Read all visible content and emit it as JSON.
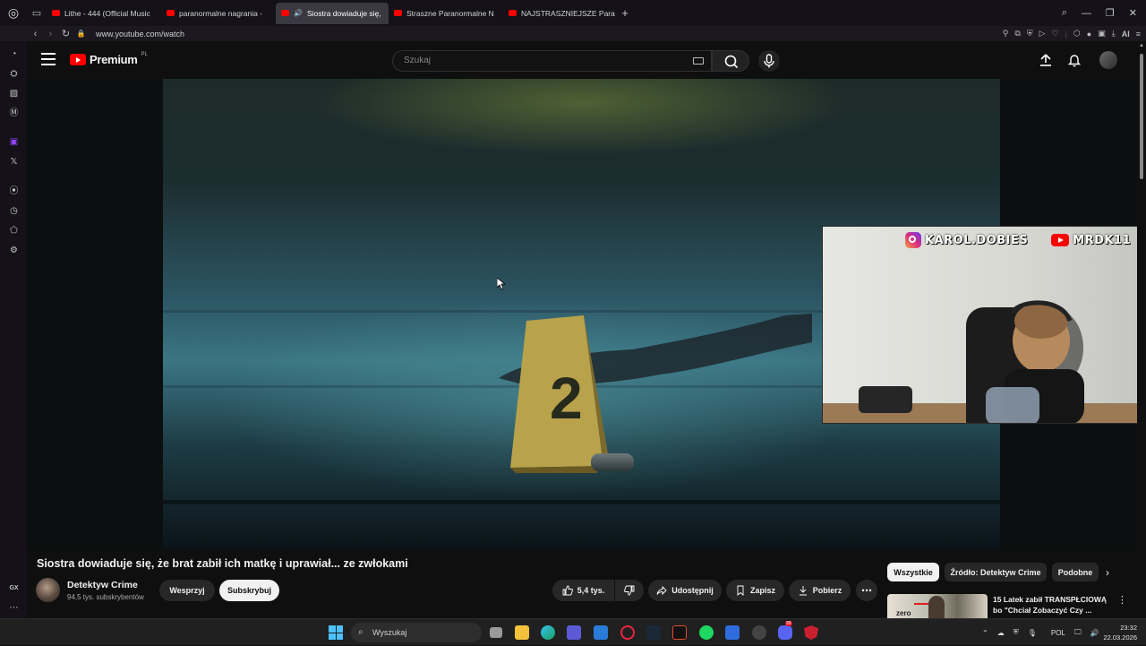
{
  "browser": {
    "tabs": [
      {
        "label": "Lithe - 444 (Official Music",
        "active": false
      },
      {
        "label": "paranormalne nagrania - ",
        "active": false
      },
      {
        "label": "Siostra dowiaduje się,",
        "active": true
      },
      {
        "label": "Straszne Paranormalne N",
        "active": false
      },
      {
        "label": "NAJSTRASZNIEJSZE Para",
        "active": false
      }
    ],
    "url": "www.youtube.com/watch",
    "ai_label": "AI"
  },
  "youtube": {
    "logo_text": "Premium",
    "logo_region": "PL",
    "search_placeholder": "Szukaj"
  },
  "overlay": {
    "instagram": "KAROL.DOBIES",
    "youtube": "MRDK11"
  },
  "video": {
    "marker_number": "2",
    "title": "Siostra dowiaduje się, że brat zabił ich matkę i uprawiał... ze zwłokami",
    "channel_name": "Detektyw Crime",
    "subscribers": "94,5 tys. subskrybentów",
    "support_label": "Wesprzyj",
    "subscribe_label": "Subskrybuj",
    "likes": "5,4 tys.",
    "share_label": "Udostępnij",
    "save_label": "Zapisz",
    "download_label": "Pobierz"
  },
  "sidebar_right": {
    "chips": [
      "Wszystkie",
      "Źródło: Detektyw Crime",
      "Podobne"
    ],
    "recommendation": {
      "title": "15 Latek zabił TRANSPŁCIOWĄ bo \"Chciał Zobaczyć Czy ...",
      "thumb_text": "zero"
    }
  },
  "opera_sidebar": {
    "gx_label": "GX"
  },
  "taskbar": {
    "search_placeholder": "Wyszukaj",
    "language": "POL",
    "time": "23:32",
    "date": "22.03.2026",
    "discord_badge": "99"
  }
}
